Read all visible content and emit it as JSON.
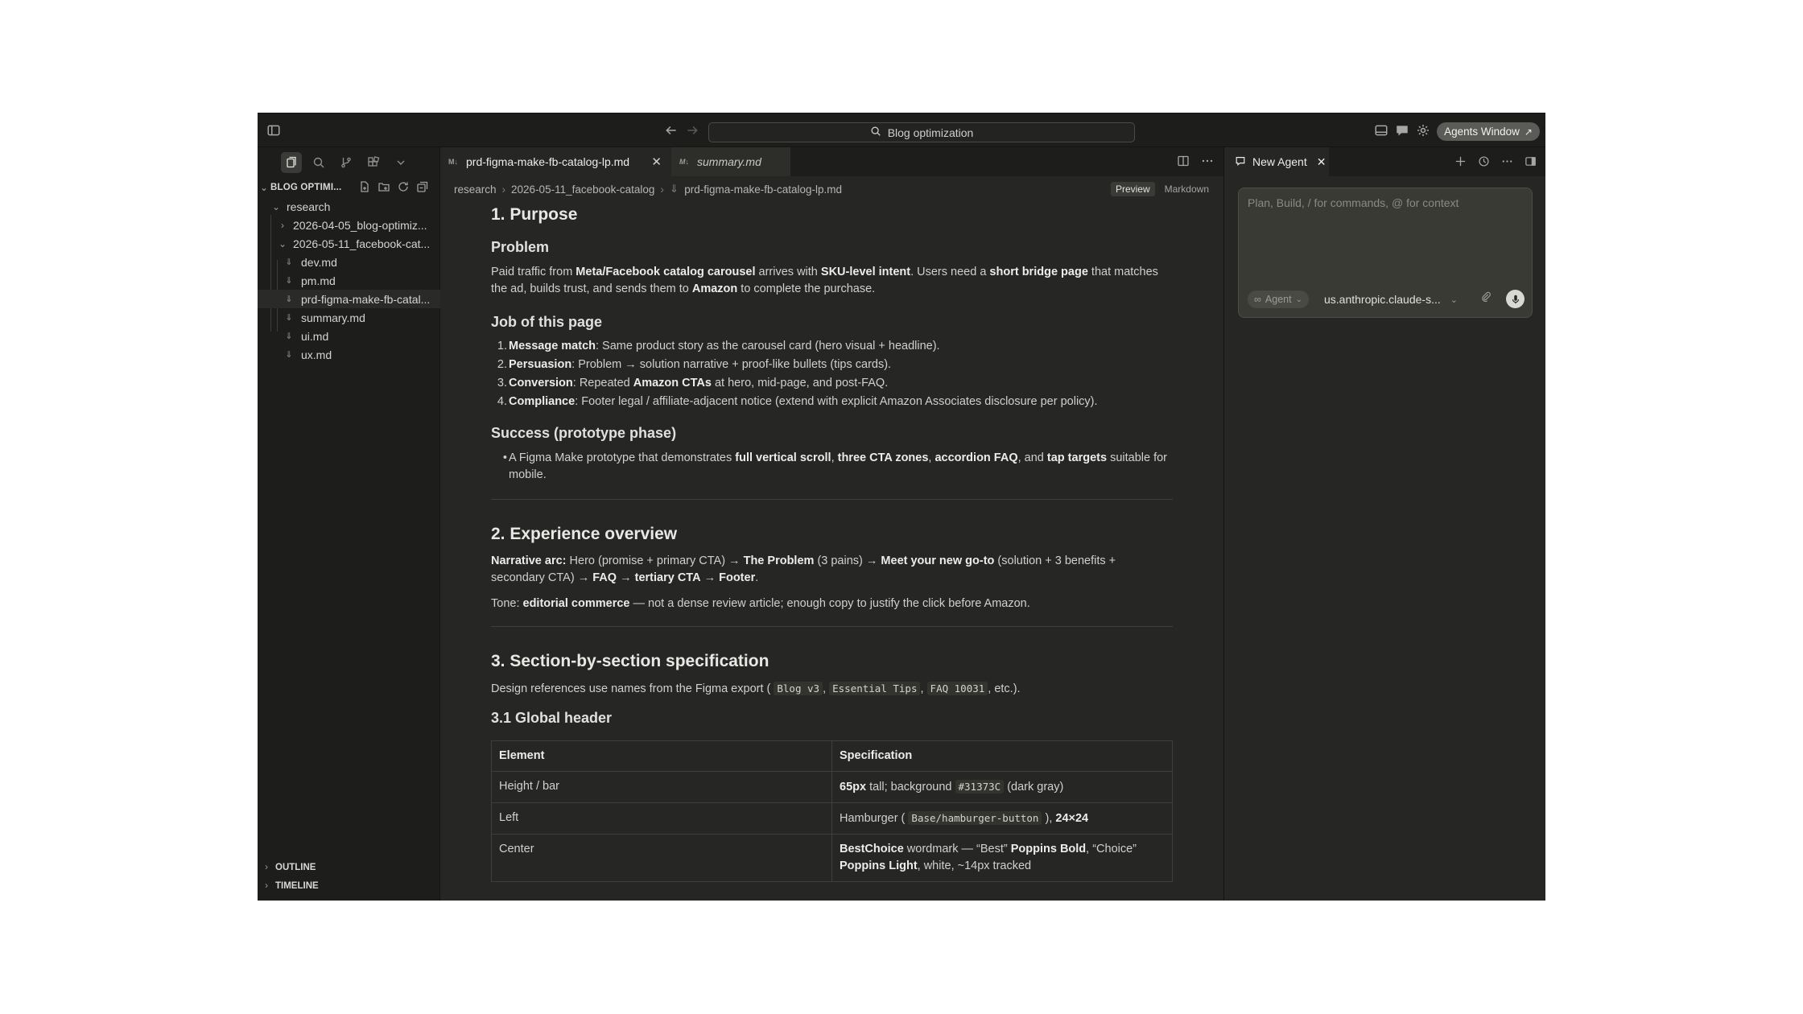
{
  "topbar": {
    "search_text": "Blog optimization",
    "agents_window": "Agents Window"
  },
  "sidebar": {
    "explorer_title": "BLOG OPTIMI...",
    "tree": [
      {
        "label": "research",
        "type": "folder",
        "open": true
      },
      {
        "label": "2026-04-05_blog-optimiz...",
        "type": "folder",
        "open": false
      },
      {
        "label": "2026-05-11_facebook-cat...",
        "type": "folder",
        "open": true
      },
      {
        "label": "dev.md",
        "type": "file"
      },
      {
        "label": "pm.md",
        "type": "file"
      },
      {
        "label": "prd-figma-make-fb-catal...",
        "type": "file"
      },
      {
        "label": "summary.md",
        "type": "file"
      },
      {
        "label": "ui.md",
        "type": "file"
      },
      {
        "label": "ux.md",
        "type": "file"
      }
    ],
    "outline": "OUTLINE",
    "timeline": "TIMELINE"
  },
  "editor": {
    "tabs": [
      {
        "label": "prd-figma-make-fb-catalog-lp.md",
        "badge": "M↓"
      },
      {
        "label": "summary.md",
        "badge": "M↓"
      }
    ],
    "breadcrumb": [
      "research",
      "2026-05-11_facebook-catalog",
      "prd-figma-make-fb-catalog-lp.md"
    ],
    "mode_preview": "Preview",
    "mode_markdown": "Markdown"
  },
  "doc": {
    "h1_purpose": "1. Purpose",
    "h2_problem": "Problem",
    "p_problem": "Paid traffic from <b>Meta/Facebook catalog carousel</b> arrives with <b>SKU-level intent</b>. Users need a <b>short bridge page</b> that matches the ad, builds trust, and sends them to <b>Amazon</b> to complete the purchase.",
    "h2_job": "Job of this page",
    "job_items": [
      "<b>Message match</b>: Same product story as the carousel card (hero visual + headline).",
      "<b>Persuasion</b>: Problem → solution narrative + proof-like bullets (tips cards).",
      "<b>Conversion</b>: Repeated <b>Amazon CTAs</b> at hero, mid-page, and post-FAQ.",
      "<b>Compliance</b>: Footer legal / affiliate-adjacent notice (extend with explicit Amazon Associates disclosure per policy)."
    ],
    "h2_success": "Success (prototype phase)",
    "success_item": "A Figma Make prototype that demonstrates <b>full vertical scroll</b>, <b>three CTA zones</b>, <b>accordion FAQ</b>, and <b>tap targets</b> suitable for mobile.",
    "h1_experience": "2. Experience overview",
    "p_arc": "<b>Narrative arc:</b> Hero (promise + primary CTA) → <b>The Problem</b> (3 pains) → <b>Meet your new go-to</b> (solution + 3 benefits + secondary CTA) → <b>FAQ</b> → <b>tertiary CTA</b> → <b>Footer</b>.",
    "p_tone": "Tone: <b>editorial commerce</b> — not a dense review article; enough copy to justify the click before Amazon.",
    "h1_section": "3. Section-by-section specification",
    "p_refs": "Design references use names from the Figma export ( <code>Blog v3</code>, <code>Essential Tips</code>, <code>FAQ 10031</code>, etc.).",
    "h2_global": "3.1 Global header",
    "table": {
      "headers": [
        "Element",
        "Specification"
      ],
      "rows": [
        [
          "Height / bar",
          "<b>65px</b> tall; background <code>#31373C</code> (dark gray)"
        ],
        [
          "Left",
          "Hamburger ( <code>Base/hamburger-button</code> ), <b>24×24</b>"
        ],
        [
          "Center",
          "<b>BestChoice</b> wordmark — “Best” <b>Poppins Bold</b>, “Choice” <b>Poppins Light</b>, white, ~14px tracked"
        ]
      ]
    }
  },
  "agent": {
    "tab_label": "New Agent",
    "placeholder": "Plan, Build, / for commands, @ for context",
    "mode_chip": "Agent",
    "model": "us.anthropic.claude-s..."
  }
}
